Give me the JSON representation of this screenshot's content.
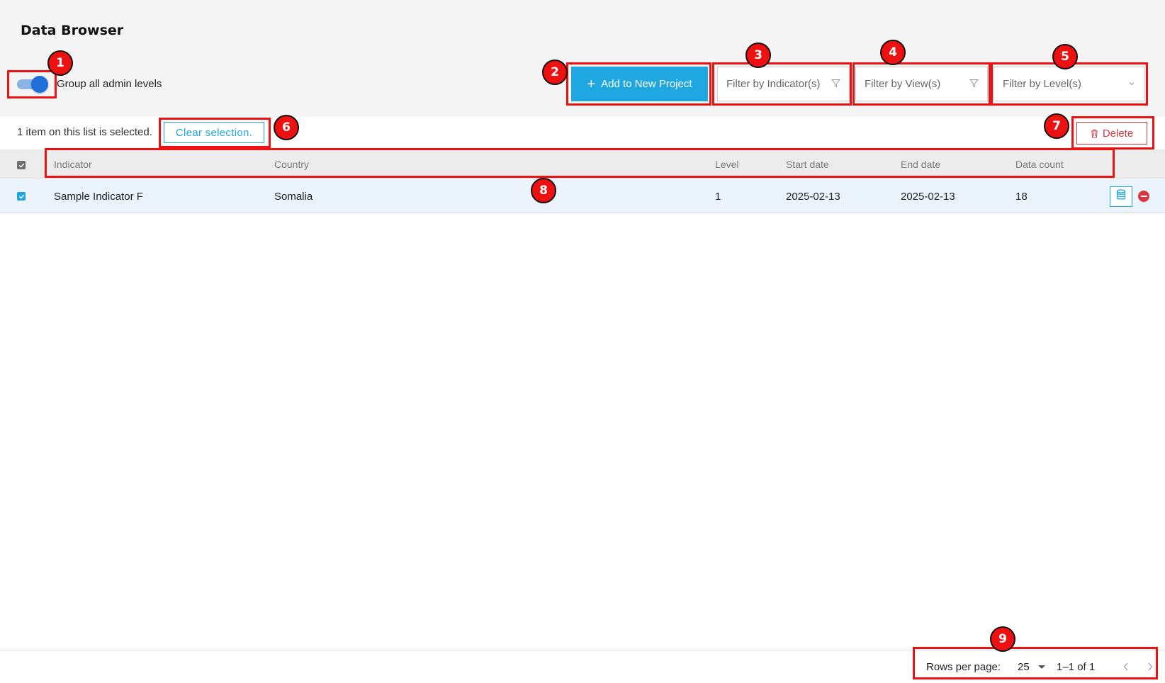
{
  "page": {
    "title": "Data Browser"
  },
  "toolbar": {
    "toggle_label": "Group all admin levels",
    "toggle_on": true,
    "add_button": "Add to New Project",
    "filter_indicator": "Filter by Indicator(s)",
    "filter_view": "Filter by View(s)",
    "filter_level": "Filter by Level(s)"
  },
  "selection": {
    "text": "1 item on this list is selected.",
    "clear_button": "Clear selection.",
    "delete_button": "Delete"
  },
  "table": {
    "columns": [
      "Indicator",
      "Country",
      "Level",
      "Start date",
      "End date",
      "Data count"
    ],
    "rows": [
      {
        "indicator": "Sample Indicator F",
        "country": "Somalia",
        "level": "1",
        "start_date": "2025-02-13",
        "end_date": "2025-02-13",
        "data_count": "18",
        "selected": true
      }
    ]
  },
  "pagination": {
    "rows_per_page_label": "Rows per page:",
    "rows_per_page": "25",
    "range": "1–1 of 1",
    "prev_icon": "chevron-left-icon",
    "next_icon": "chevron-right-icon"
  },
  "annotations": [
    "1",
    "2",
    "3",
    "4",
    "5",
    "6",
    "7",
    "8",
    "9"
  ],
  "colors": {
    "accent": "#1ea7e1",
    "danger": "#d9363e",
    "annotation": "#ee1111",
    "toggle": "#1e6fd9"
  }
}
